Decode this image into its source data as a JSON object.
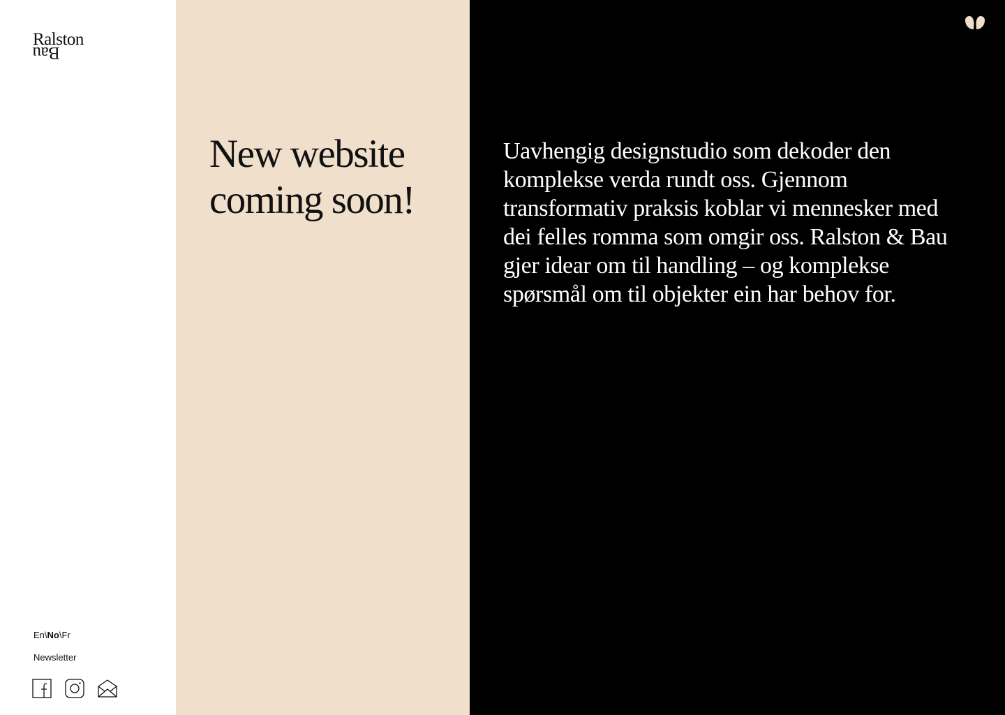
{
  "logo": {
    "line1": "Ralston",
    "line2": "Bau"
  },
  "language": {
    "options": [
      "En",
      "No",
      "Fr"
    ],
    "separator": "\\",
    "selected": "No"
  },
  "newsletter_label": "Newsletter",
  "social_icons": [
    "facebook-icon",
    "instagram-icon",
    "mail-icon"
  ],
  "headline": {
    "line1": "New website",
    "line2": "coming soon!"
  },
  "description": "Uavhengig designstudio som dekoder den komplekse verda rundt oss. Gjennom transformativ praksis koblar vi mennesker med dei felles romma som omgir oss. Ralston & Bau gjer idear om til handling – og komplekse spørsmål om til objekter ein har behov for.",
  "colors": {
    "sidebar_bg": "#ffffff",
    "middle_bg": "#f0dfcb",
    "right_bg": "#000000",
    "accent": "#f0dfcb"
  }
}
